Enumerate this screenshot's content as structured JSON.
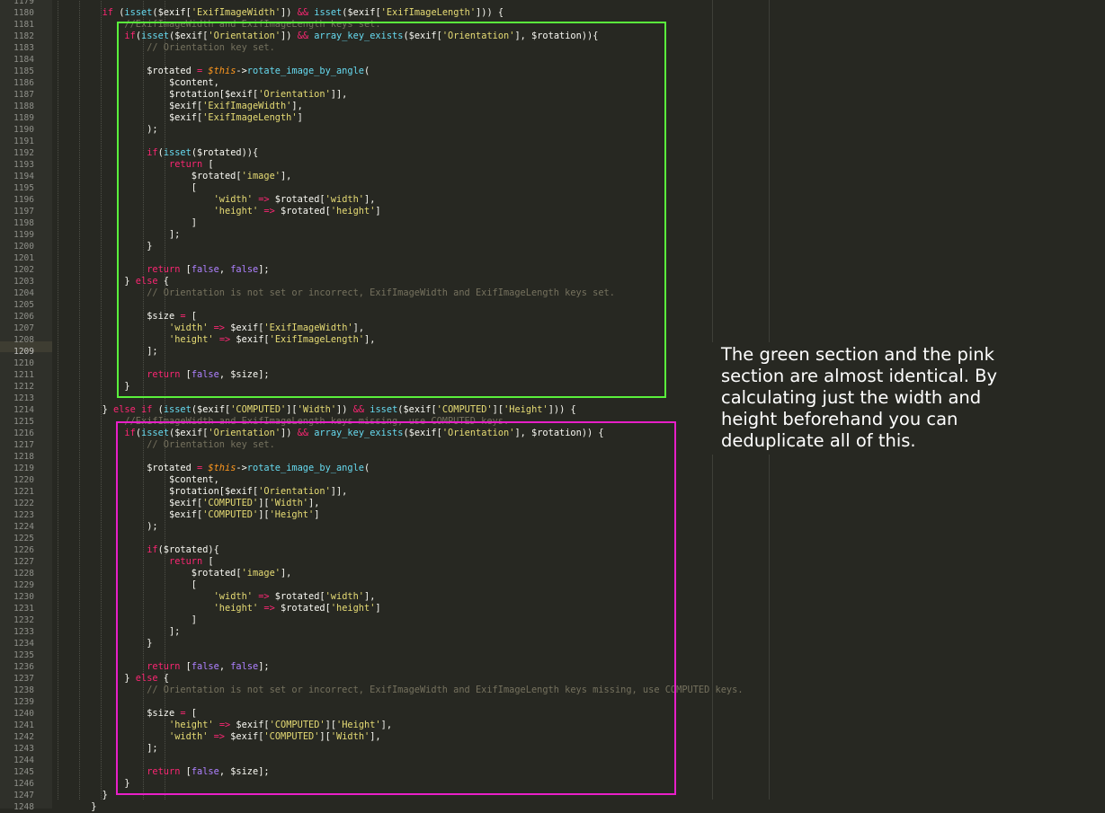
{
  "editor": {
    "active_line": 1209,
    "line_numbers": [
      "1179",
      "1180",
      "1181",
      "1182",
      "1183",
      "1184",
      "1185",
      "1186",
      "1187",
      "1188",
      "1189",
      "1190",
      "1191",
      "1192",
      "1193",
      "1194",
      "1195",
      "1196",
      "1197",
      "1198",
      "1199",
      "1200",
      "1201",
      "1202",
      "1203",
      "1204",
      "1205",
      "1206",
      "1207",
      "1208",
      "1209",
      "1210",
      "1211",
      "1212",
      "1213",
      "1214",
      "1215",
      "1216",
      "1217",
      "1218",
      "1219",
      "1220",
      "1221",
      "1222",
      "1223",
      "1224",
      "1225",
      "1226",
      "1227",
      "1228",
      "1229",
      "1230",
      "1231",
      "1232",
      "1233",
      "1234",
      "1235",
      "1236",
      "1237",
      "1238",
      "1239",
      "1240",
      "1241",
      "1242",
      "1243",
      "1244",
      "1245",
      "1246",
      "1247",
      "1248"
    ],
    "code_lines": [
      [],
      [
        [
          "        ",
          ""
        ],
        [
          "if",
          "k"
        ],
        [
          " (",
          ""
        ],
        [
          "isset",
          "f"
        ],
        [
          "($exif[",
          ""
        ],
        [
          "'ExifImageWidth'",
          "s"
        ],
        [
          "]) ",
          ""
        ],
        [
          "&&",
          "k"
        ],
        [
          " ",
          ""
        ],
        [
          "isset",
          "f"
        ],
        [
          "($exif[",
          ""
        ],
        [
          "'ExifImageLength'",
          "s"
        ],
        [
          "])) {",
          ""
        ]
      ],
      [
        [
          "            ",
          ""
        ],
        [
          "//ExifImageWidth and ExifImageLength keys set.",
          "c"
        ]
      ],
      [
        [
          "            ",
          ""
        ],
        [
          "if",
          "k"
        ],
        [
          "(",
          ""
        ],
        [
          "isset",
          "f"
        ],
        [
          "($exif[",
          ""
        ],
        [
          "'Orientation'",
          "s"
        ],
        [
          "]) ",
          ""
        ],
        [
          "&&",
          "k"
        ],
        [
          " ",
          ""
        ],
        [
          "array_key_exists",
          "f"
        ],
        [
          "($exif[",
          ""
        ],
        [
          "'Orientation'",
          "s"
        ],
        [
          "], $rotation)){",
          ""
        ]
      ],
      [
        [
          "                ",
          ""
        ],
        [
          "// Orientation key set.",
          "c"
        ]
      ],
      [],
      [
        [
          "                $rotated ",
          ""
        ],
        [
          "=",
          "k"
        ],
        [
          " ",
          ""
        ],
        [
          "$this",
          "t"
        ],
        [
          "->",
          ""
        ],
        [
          "rotate_image_by_angle",
          "f"
        ],
        [
          "(",
          ""
        ]
      ],
      [
        [
          "                    $content,",
          ""
        ]
      ],
      [
        [
          "                    $rotation[$exif[",
          ""
        ],
        [
          "'Orientation'",
          "s"
        ],
        [
          "]],",
          ""
        ]
      ],
      [
        [
          "                    $exif[",
          ""
        ],
        [
          "'ExifImageWidth'",
          "s"
        ],
        [
          "],",
          ""
        ]
      ],
      [
        [
          "                    $exif[",
          ""
        ],
        [
          "'ExifImageLength'",
          "s"
        ],
        [
          "]",
          ""
        ]
      ],
      [
        [
          "                );",
          ""
        ]
      ],
      [],
      [
        [
          "                ",
          ""
        ],
        [
          "if",
          "k"
        ],
        [
          "(",
          ""
        ],
        [
          "isset",
          "f"
        ],
        [
          "($rotated)){",
          ""
        ]
      ],
      [
        [
          "                    ",
          ""
        ],
        [
          "return",
          "k"
        ],
        [
          " [",
          ""
        ]
      ],
      [
        [
          "                        $rotated[",
          ""
        ],
        [
          "'image'",
          "s"
        ],
        [
          "],",
          ""
        ]
      ],
      [
        [
          "                        [",
          ""
        ]
      ],
      [
        [
          "                            ",
          ""
        ],
        [
          "'width'",
          "s"
        ],
        [
          " ",
          ""
        ],
        [
          "=>",
          "o"
        ],
        [
          " $rotated[",
          ""
        ],
        [
          "'width'",
          "s"
        ],
        [
          "],",
          ""
        ]
      ],
      [
        [
          "                            ",
          ""
        ],
        [
          "'height'",
          "s"
        ],
        [
          " ",
          ""
        ],
        [
          "=>",
          "o"
        ],
        [
          " $rotated[",
          ""
        ],
        [
          "'height'",
          "s"
        ],
        [
          "]",
          ""
        ]
      ],
      [
        [
          "                        ]",
          ""
        ]
      ],
      [
        [
          "                    ];",
          ""
        ]
      ],
      [
        [
          "                }",
          ""
        ]
      ],
      [],
      [
        [
          "                ",
          ""
        ],
        [
          "return",
          "k"
        ],
        [
          " [",
          ""
        ],
        [
          "false",
          "v"
        ],
        [
          ", ",
          ""
        ],
        [
          "false",
          "v"
        ],
        [
          "];",
          ""
        ]
      ],
      [
        [
          "            } ",
          ""
        ],
        [
          "else",
          "k"
        ],
        [
          " {",
          ""
        ]
      ],
      [
        [
          "                ",
          ""
        ],
        [
          "// Orientation is not set or incorrect, ExifImageWidth and ExifImageLength keys set.",
          "c"
        ]
      ],
      [],
      [
        [
          "                $size ",
          ""
        ],
        [
          "=",
          "k"
        ],
        [
          " [",
          ""
        ]
      ],
      [
        [
          "                    ",
          ""
        ],
        [
          "'width'",
          "s"
        ],
        [
          " ",
          ""
        ],
        [
          "=>",
          "o"
        ],
        [
          " $exif[",
          ""
        ],
        [
          "'ExifImageWidth'",
          "s"
        ],
        [
          "],",
          ""
        ]
      ],
      [
        [
          "                    ",
          ""
        ],
        [
          "'height'",
          "s"
        ],
        [
          " ",
          ""
        ],
        [
          "=>",
          "o"
        ],
        [
          " $exif[",
          ""
        ],
        [
          "'ExifImageLength'",
          "s"
        ],
        [
          "],",
          ""
        ]
      ],
      [
        [
          "                ];",
          ""
        ]
      ],
      [],
      [
        [
          "                ",
          ""
        ],
        [
          "return",
          "k"
        ],
        [
          " [",
          ""
        ],
        [
          "false",
          "v"
        ],
        [
          ", $size];",
          ""
        ]
      ],
      [
        [
          "            }",
          ""
        ]
      ],
      [],
      [
        [
          "        } ",
          ""
        ],
        [
          "else",
          "k"
        ],
        [
          " ",
          ""
        ],
        [
          "if",
          "k"
        ],
        [
          " (",
          ""
        ],
        [
          "isset",
          "f"
        ],
        [
          "($exif[",
          ""
        ],
        [
          "'COMPUTED'",
          "s"
        ],
        [
          "][",
          ""
        ],
        [
          "'Width'",
          "s"
        ],
        [
          "]) ",
          ""
        ],
        [
          "&&",
          "k"
        ],
        [
          " ",
          ""
        ],
        [
          "isset",
          "f"
        ],
        [
          "($exif[",
          ""
        ],
        [
          "'COMPUTED'",
          "s"
        ],
        [
          "][",
          ""
        ],
        [
          "'Height'",
          "s"
        ],
        [
          "])) {",
          ""
        ]
      ],
      [
        [
          "            ",
          ""
        ],
        [
          "//ExifImageWidth and ExifImageLength keys missing, use COMPUTED keys.",
          "c"
        ]
      ],
      [
        [
          "            ",
          ""
        ],
        [
          "if",
          "k"
        ],
        [
          "(",
          ""
        ],
        [
          "isset",
          "f"
        ],
        [
          "($exif[",
          ""
        ],
        [
          "'Orientation'",
          "s"
        ],
        [
          "]) ",
          ""
        ],
        [
          "&&",
          "k"
        ],
        [
          " ",
          ""
        ],
        [
          "array_key_exists",
          "f"
        ],
        [
          "($exif[",
          ""
        ],
        [
          "'Orientation'",
          "s"
        ],
        [
          "], $rotation)) {",
          ""
        ]
      ],
      [
        [
          "                ",
          ""
        ],
        [
          "// Orientation key set.",
          "c"
        ]
      ],
      [],
      [
        [
          "                $rotated ",
          ""
        ],
        [
          "=",
          "k"
        ],
        [
          " ",
          ""
        ],
        [
          "$this",
          "t"
        ],
        [
          "->",
          ""
        ],
        [
          "rotate_image_by_angle",
          "f"
        ],
        [
          "(",
          ""
        ]
      ],
      [
        [
          "                    $content,",
          ""
        ]
      ],
      [
        [
          "                    $rotation[$exif[",
          ""
        ],
        [
          "'Orientation'",
          "s"
        ],
        [
          "]],",
          ""
        ]
      ],
      [
        [
          "                    $exif[",
          ""
        ],
        [
          "'COMPUTED'",
          "s"
        ],
        [
          "][",
          ""
        ],
        [
          "'Width'",
          "s"
        ],
        [
          "],",
          ""
        ]
      ],
      [
        [
          "                    $exif[",
          ""
        ],
        [
          "'COMPUTED'",
          "s"
        ],
        [
          "][",
          ""
        ],
        [
          "'Height'",
          "s"
        ],
        [
          "]",
          ""
        ]
      ],
      [
        [
          "                );",
          ""
        ]
      ],
      [],
      [
        [
          "                ",
          ""
        ],
        [
          "if",
          "k"
        ],
        [
          "($rotated){",
          ""
        ]
      ],
      [
        [
          "                    ",
          ""
        ],
        [
          "return",
          "k"
        ],
        [
          " [",
          ""
        ]
      ],
      [
        [
          "                        $rotated[",
          ""
        ],
        [
          "'image'",
          "s"
        ],
        [
          "],",
          ""
        ]
      ],
      [
        [
          "                        [",
          ""
        ]
      ],
      [
        [
          "                            ",
          ""
        ],
        [
          "'width'",
          "s"
        ],
        [
          " ",
          ""
        ],
        [
          "=>",
          "o"
        ],
        [
          " $rotated[",
          ""
        ],
        [
          "'width'",
          "s"
        ],
        [
          "],",
          ""
        ]
      ],
      [
        [
          "                            ",
          ""
        ],
        [
          "'height'",
          "s"
        ],
        [
          " ",
          ""
        ],
        [
          "=>",
          "o"
        ],
        [
          " $rotated[",
          ""
        ],
        [
          "'height'",
          "s"
        ],
        [
          "]",
          ""
        ]
      ],
      [
        [
          "                        ]",
          ""
        ]
      ],
      [
        [
          "                    ];",
          ""
        ]
      ],
      [
        [
          "                }",
          ""
        ]
      ],
      [],
      [
        [
          "                ",
          ""
        ],
        [
          "return",
          "k"
        ],
        [
          " [",
          ""
        ],
        [
          "false",
          "v"
        ],
        [
          ", ",
          ""
        ],
        [
          "false",
          "v"
        ],
        [
          "];",
          ""
        ]
      ],
      [
        [
          "            } ",
          ""
        ],
        [
          "else",
          "k"
        ],
        [
          " {",
          ""
        ]
      ],
      [
        [
          "                ",
          ""
        ],
        [
          "// Orientation is not set or incorrect, ExifImageWidth and ExifImageLength keys missing, use COMPUTED keys.",
          "c"
        ]
      ],
      [],
      [
        [
          "                $size ",
          ""
        ],
        [
          "=",
          "k"
        ],
        [
          " [",
          ""
        ]
      ],
      [
        [
          "                    ",
          ""
        ],
        [
          "'height'",
          "s"
        ],
        [
          " ",
          ""
        ],
        [
          "=>",
          "o"
        ],
        [
          " $exif[",
          ""
        ],
        [
          "'COMPUTED'",
          "s"
        ],
        [
          "][",
          ""
        ],
        [
          "'Height'",
          "s"
        ],
        [
          "],",
          ""
        ]
      ],
      [
        [
          "                    ",
          ""
        ],
        [
          "'width'",
          "s"
        ],
        [
          " ",
          ""
        ],
        [
          "=>",
          "o"
        ],
        [
          " $exif[",
          ""
        ],
        [
          "'COMPUTED'",
          "s"
        ],
        [
          "][",
          ""
        ],
        [
          "'Width'",
          "s"
        ],
        [
          "],",
          ""
        ]
      ],
      [
        [
          "                ];",
          ""
        ]
      ],
      [],
      [
        [
          "                ",
          ""
        ],
        [
          "return",
          "k"
        ],
        [
          " [",
          ""
        ],
        [
          "false",
          "v"
        ],
        [
          ", $size];",
          ""
        ]
      ],
      [
        [
          "            }",
          ""
        ]
      ],
      [
        [
          "        }",
          ""
        ]
      ],
      [
        [
          "      }",
          ""
        ]
      ]
    ]
  },
  "highlights": {
    "green": "#5af03c",
    "pink": "#e81fc8"
  },
  "annotation": {
    "text": "The green section and the pink section are almost identical. By calculating just the width and height beforehand you can deduplicate all of this."
  }
}
